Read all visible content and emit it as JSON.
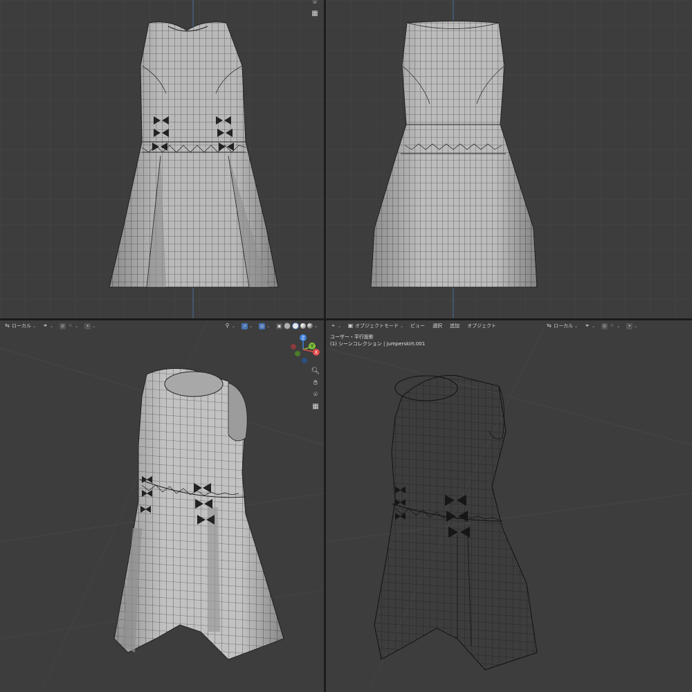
{
  "viewport_bottom_left_header": {
    "transform_orientation": "ローカル",
    "pivot_icon": "pivot-icon",
    "snap_icon": "snap-icon",
    "proportional_icon": "proportional-icon"
  },
  "viewport_bottom_right_header": {
    "editor_type_icon": "editor-type-icon",
    "mode": "オブジェクトモード",
    "menus": [
      "ビュー",
      "選択",
      "追加",
      "オブジェクト"
    ],
    "transform_orientation": "ローカル"
  },
  "viewport_bottom_right_overlay": {
    "view_name": "ユーザー・平行投影",
    "collection_info": "(1) シーンコレクション | jumperskirt.001"
  },
  "navigation_gizmo": {
    "axes": [
      "Z",
      "Y",
      "X"
    ],
    "colors": {
      "x": "#e04a4a",
      "y": "#7fbf3a",
      "z": "#3d7fd9"
    }
  },
  "side_tools": [
    "zoom-icon",
    "hand-pan-icon",
    "camera-icon",
    "grid-toggle-icon"
  ],
  "colors": {
    "viewport_bg": "#3d3d3d",
    "grid_line": "#474747",
    "mesh_fill": "#b8b8b8",
    "wire": "#1a1a1a",
    "accent": "#4772b3"
  }
}
